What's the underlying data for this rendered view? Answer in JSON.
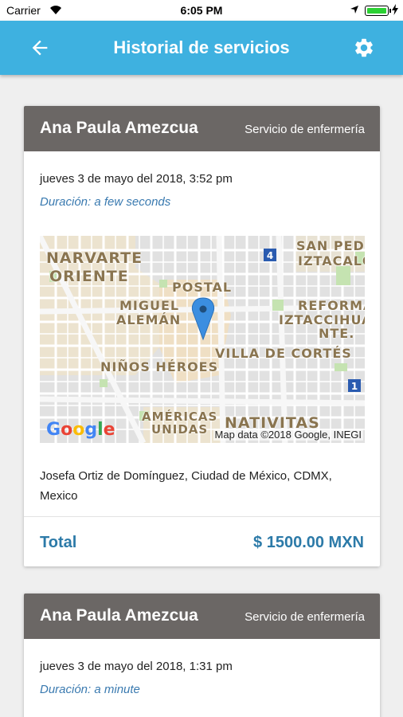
{
  "status_bar": {
    "carrier": "Carrier",
    "time": "6:05 PM"
  },
  "app_bar": {
    "title": "Historial de servicios",
    "back_icon": "arrow-left-icon",
    "settings_icon": "gear-icon",
    "color": "#3eb1e0"
  },
  "services": [
    {
      "name": "Ana Paula Amezcua",
      "service_type": "Servicio de enfermería",
      "date": "jueves 3 de mayo del 2018, 3:52 pm",
      "duration": "Duración: a few seconds",
      "map": {
        "labels": [
          "NARVARTE",
          "ORIENTE",
          "SAN PEDR",
          "IZTACALC",
          "POSTAL",
          "MIGUEL",
          "ALEMÁN",
          "REFORMA",
          "IZTACCIHUA",
          "NTE.",
          "VILLA DE CORTÉS",
          "NIÑOS HÉROES",
          "AMÉRICAS",
          "UNIDAS",
          "NATIVITAS"
        ],
        "shields": [
          "4",
          "1"
        ],
        "logo": "Google",
        "attribution": "Map data ©2018 Google, INEGI"
      },
      "address": "Josefa Ortiz de Domínguez, Ciudad de México, CDMX, Mexico",
      "total_label": "Total",
      "total_value": "$ 1500.00 MXN"
    },
    {
      "name": "Ana Paula Amezcua",
      "service_type": "Servicio de enfermería",
      "date": "jueves 3 de mayo del 2018, 1:31 pm",
      "duration": "Duración: a minute"
    }
  ]
}
